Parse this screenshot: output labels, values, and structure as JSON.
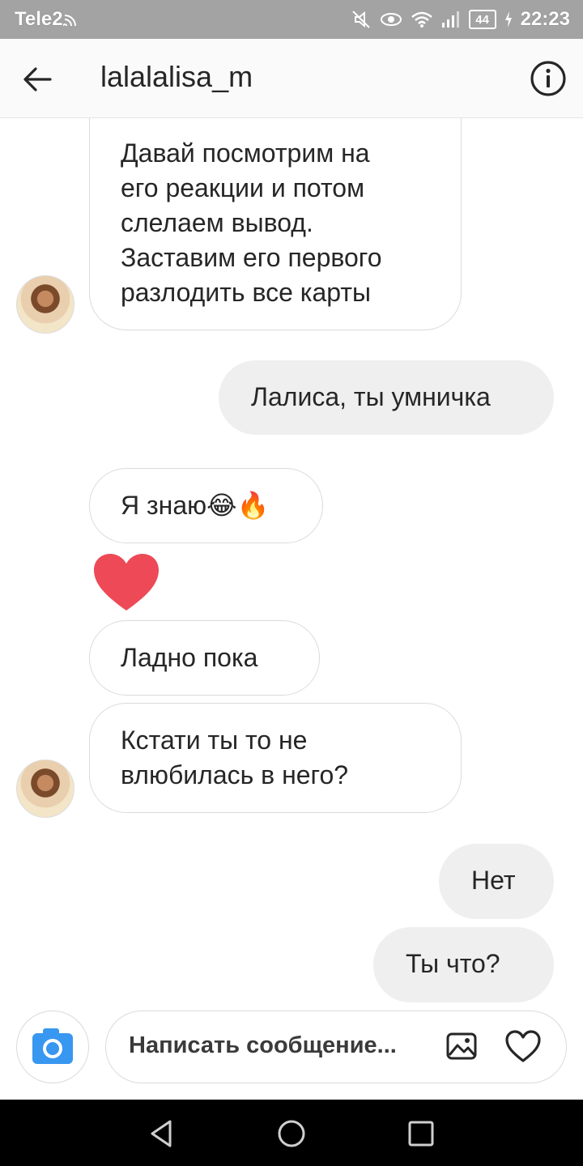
{
  "status_bar": {
    "carrier": "Tele2",
    "battery": "44",
    "time": "22:23"
  },
  "header": {
    "title": "lalalalisa_m"
  },
  "messages": [
    {
      "side": "in",
      "lines": [
        "Давай посмотрим на",
        "его реакции и потом",
        "слелаем вывод.",
        "Заставим его первого",
        "разлодить все карты"
      ]
    },
    {
      "side": "out",
      "text": "Лалиса, ты умничка"
    },
    {
      "side": "in",
      "text": "Я знаю😂🔥"
    },
    {
      "side": "in",
      "type": "heart-emoji"
    },
    {
      "side": "in",
      "text": "Ладно пока"
    },
    {
      "side": "in",
      "lines": [
        "Кстати ты то не",
        "влюбилась в него?"
      ]
    },
    {
      "side": "out",
      "text": "Нет"
    },
    {
      "side": "out",
      "text": "Ты что?"
    }
  ],
  "composer": {
    "placeholder": "Написать сообщение..."
  },
  "icons": {
    "back": "arrow-left-icon",
    "info": "info-icon",
    "camera": "camera-icon",
    "gallery": "image-icon",
    "like": "heart-icon"
  },
  "colors": {
    "status_bar": "#a3a3a3",
    "camera_blue": "#3897f0",
    "outgoing_bubble": "#efefef",
    "heart_red": "#ed4956"
  }
}
